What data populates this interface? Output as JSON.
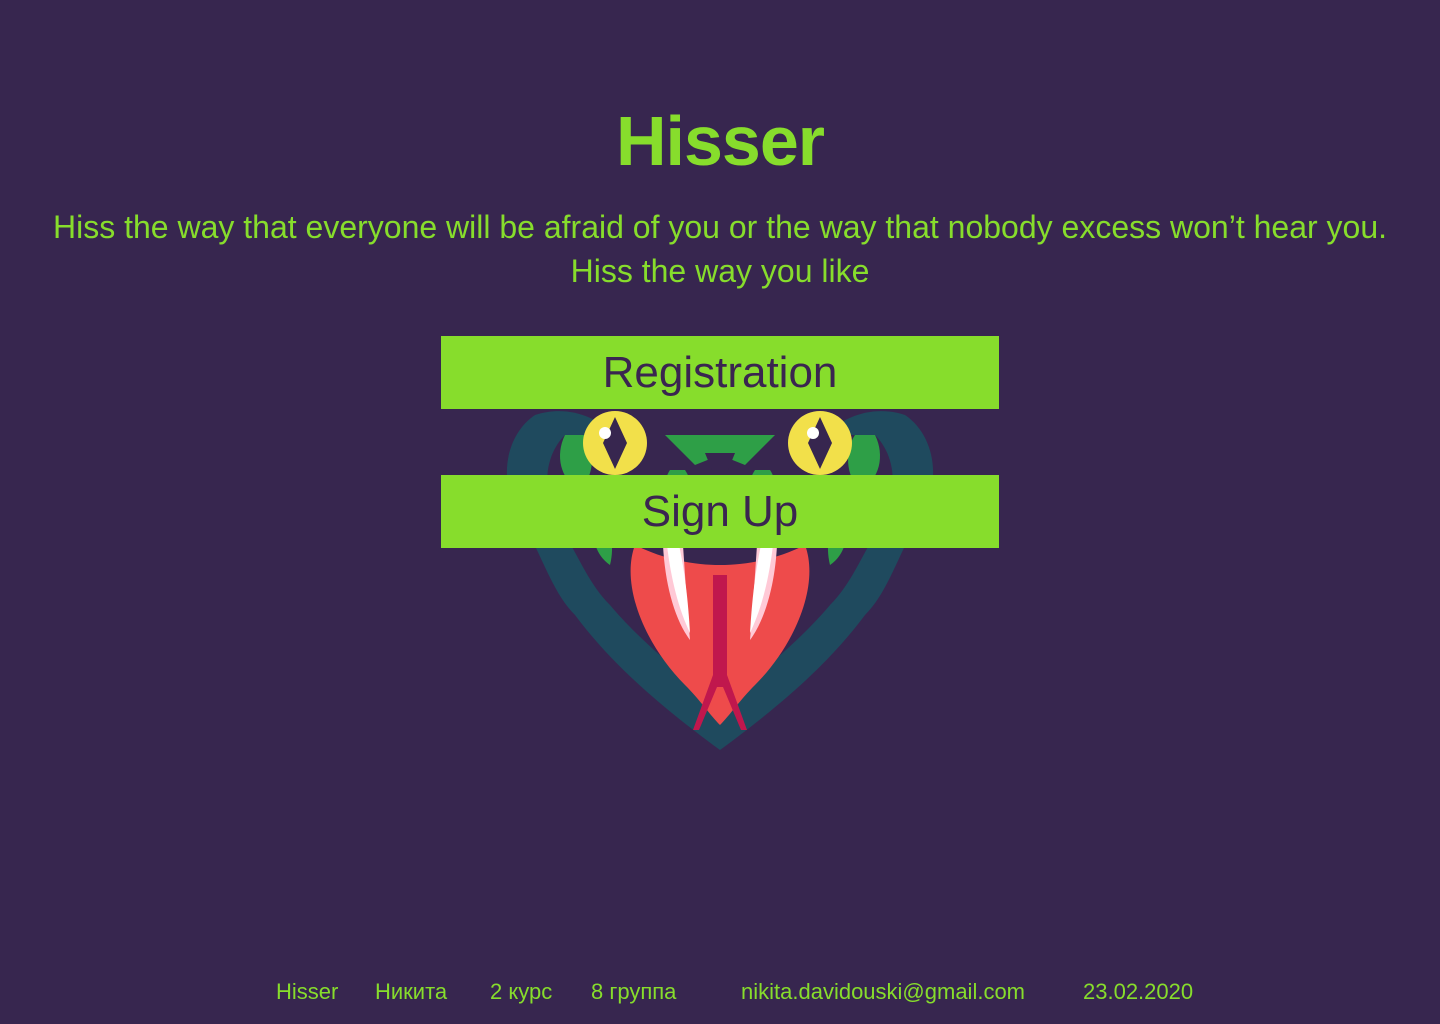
{
  "header": {
    "title": "Hisser",
    "tagline_line1": "Hiss the way that everyone will be afraid of you or the way that nobody excess won’t hear you.",
    "tagline_line2": "Hiss the way you like"
  },
  "actions": {
    "registration_label": "Registration",
    "signup_label": "Sign Up"
  },
  "illustration": {
    "icon": "snake-head-icon",
    "colors": {
      "background": "#37264f",
      "accent": "#87dd2c",
      "dark_teal": "#1f4a5e",
      "green": "#2e9f47",
      "eye_yellow": "#f2e04a",
      "mouth_red": "#ee4b4b",
      "tongue": "#c0174d",
      "fang": "#ffffff"
    }
  },
  "footer": {
    "site": "Hisser",
    "name": "Никита",
    "course": "2 курс",
    "group": "8 группа",
    "email": "nikita.davidouski@gmail.com",
    "date": "23.02.2020"
  }
}
